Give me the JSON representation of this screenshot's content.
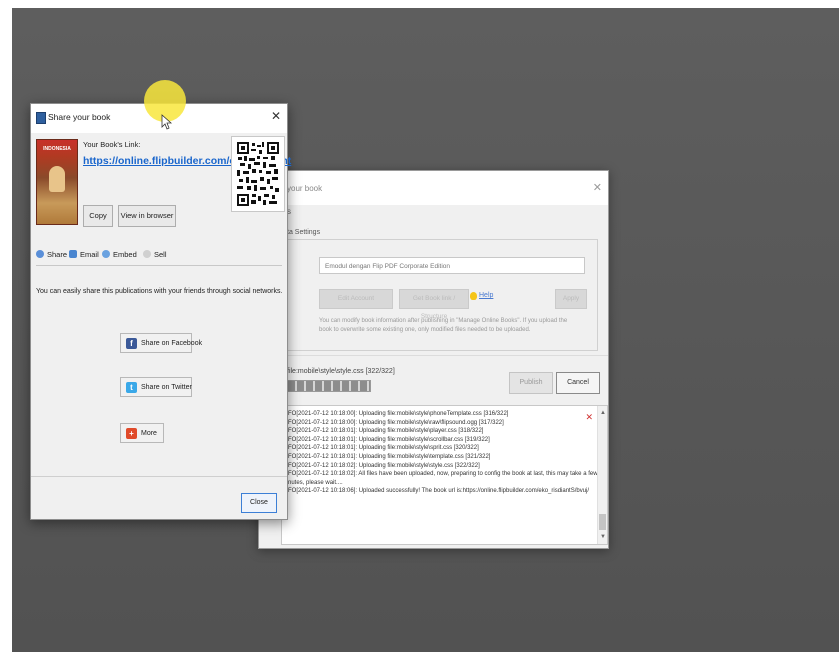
{
  "colors": {
    "desktop": "#5a5a5a",
    "link": "#1a66cc",
    "highlight": "#f8e63c",
    "facebook": "#3b5998",
    "twitter": "#3aa8e8",
    "more": "#e04a2a"
  },
  "publish_window": {
    "title": "your book",
    "tab": "s",
    "section_label": "ta Settings",
    "book_title_value": "Emodul dengan Flip PDF Corporate Edition",
    "button_edit": "Edit Account",
    "button_get": "Get Book link / Structure",
    "help_label": "Help",
    "button_apply": "Apply",
    "note": "You can modify book information after publishing in \"Manage Online Books\". If you upload the book to overwrite some existing one, only modified files needed to be uploaded.",
    "current_file": "file:mobile\\style\\style.css [322/322]",
    "progress": 1.0,
    "publish_label": "Publish",
    "cancel_label": "Cancel",
    "log_lines": [
      "FO[2021-07-12 10:18:00]: Uploading file:mobile\\style\\phoneTemplate.css [316/322]",
      "FO[2021-07-12 10:18:00]: Uploading file:mobile\\style\\raw\\flipsound.ogg [317/322]",
      "FO[2021-07-12 10:18:01]: Uploading file:mobile\\style\\player.css [318/322]",
      "FO[2021-07-12 10:18:01]: Uploading file:mobile\\style\\scrollbar.css [319/322]",
      "FO[2021-07-12 10:18:01]: Uploading file:mobile\\style\\sprit.css [320/322]",
      "FO[2021-07-12 10:18:01]: Uploading file:mobile\\style\\template.css [321/322]",
      "FO[2021-07-12 10:18:02]: Uploading file:mobile\\style\\style.css [322/322]",
      "FO[2021-07-12 10:18:02]: All files have been uploaded, now, preparing to config the book at last, this may take a few",
      "nutes, please wait....",
      "FO[2021-07-12 10:18:06]: Uploaded successfully! The book url is:https://online.flipbuilder.com/eko_risdiantS/bvuj/"
    ]
  },
  "share_dialog": {
    "title": "Share your book",
    "cover_text": "INDONESIA",
    "link_label": "Your Book's Link:",
    "book_link": "https://online.flipbuilder.com/eko_risdiant",
    "copy_label": "Copy",
    "view_label": "View in browser",
    "tabs": [
      "Share",
      "Email",
      "Embed",
      "Sell"
    ],
    "share_description": "You can easily share this publications with your friends through social networks.",
    "facebook_label": "Share on Facebook",
    "twitter_label": "Share on Twitter",
    "more_label": "More",
    "close_label": "Close"
  }
}
